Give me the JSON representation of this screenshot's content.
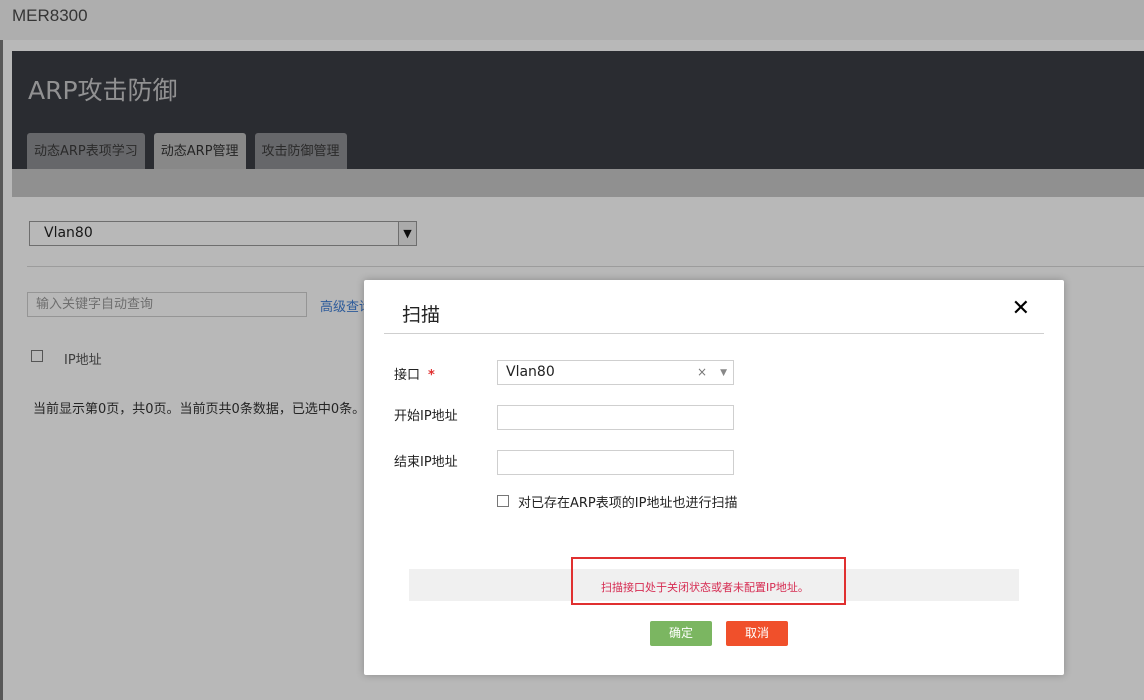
{
  "app": {
    "brand": "MER8300"
  },
  "header": {
    "title": "ARP攻击防御",
    "tabs": [
      {
        "label": "动态ARP表项学习",
        "active": false
      },
      {
        "label": "动态ARP管理",
        "active": true
      },
      {
        "label": "攻击防御管理",
        "active": false
      }
    ]
  },
  "content": {
    "interface_select_value": "Vlan80",
    "search_placeholder": "输入关键字自动查询",
    "advanced_search_label": "高级查询",
    "table_headers": [
      "IP地址"
    ],
    "page_info": "当前显示第0页，共0页。当前页共0条数据，已选中0条。"
  },
  "modal": {
    "title": "扫描",
    "close_symbol": "✕",
    "interface_label": "接口",
    "required_mark": "*",
    "interface_value": "Vlan80",
    "clear_symbol": "×",
    "start_ip_label": "开始IP地址",
    "start_ip_value": "",
    "end_ip_label": "结束IP地址",
    "end_ip_value": "",
    "scan_existing_label": "对已存在ARP表项的IP地址也进行扫描",
    "scan_existing_checked": false,
    "error_message": "扫描接口处于关闭状态或者未配置IP地址。",
    "ok_label": "确定",
    "cancel_label": "取消"
  },
  "colors": {
    "header_bg": "#3b3d44",
    "ok_button": "#7bb661",
    "cancel_button": "#f0502b",
    "error_text": "#d62c52",
    "highlight_box": "#e03030",
    "link": "#3f7fd6"
  }
}
